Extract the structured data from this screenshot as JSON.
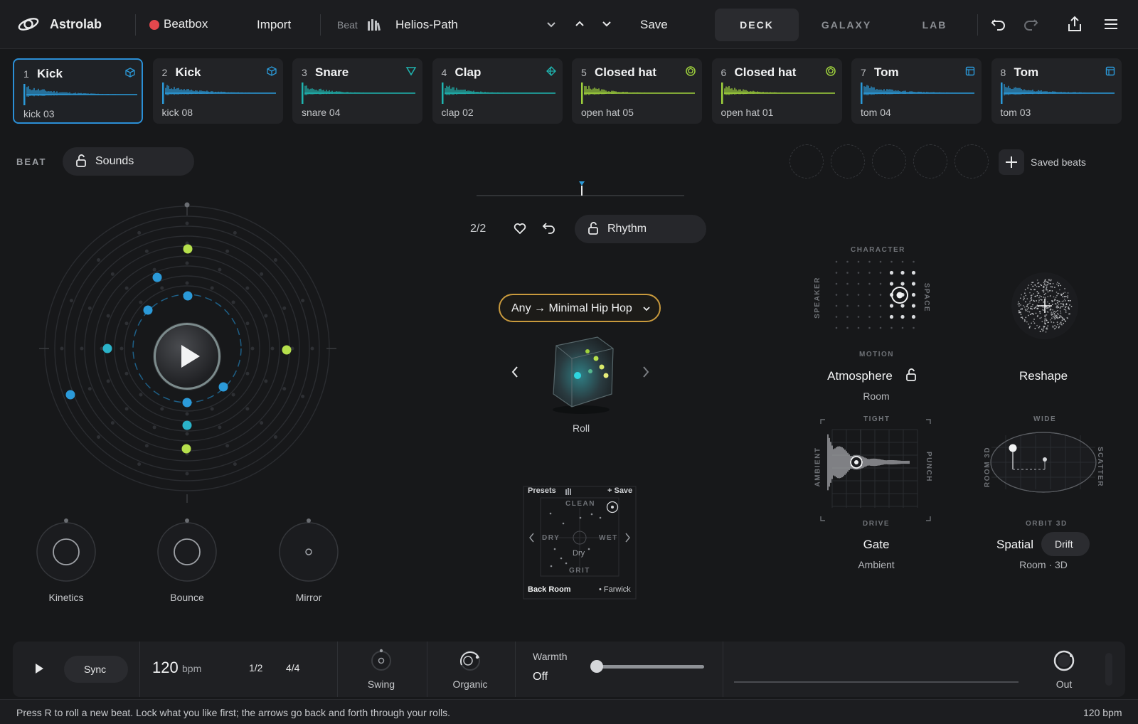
{
  "app": {
    "name": "Astrolab"
  },
  "topbar": {
    "mode_label": "Beatbox",
    "import_label": "Import",
    "beat_prefix": "Beat",
    "beat_name": "Helios-Path",
    "save_label": "Save",
    "tabs": [
      {
        "label": "DECK",
        "active": true
      },
      {
        "label": "GALAXY",
        "active": false
      },
      {
        "label": "LAB",
        "active": false
      }
    ]
  },
  "tracks": [
    {
      "num": "1",
      "name": "Kick",
      "sample": "kick 03",
      "icon": "cube-icon",
      "color": "#2b9ad9",
      "selected": true
    },
    {
      "num": "2",
      "name": "Kick",
      "sample": "kick 08",
      "icon": "cube-icon",
      "color": "#2b9ad9",
      "selected": false
    },
    {
      "num": "3",
      "name": "Snare",
      "sample": "snare 04",
      "icon": "triangle-icon",
      "color": "#1fb5b0",
      "selected": false
    },
    {
      "num": "4",
      "name": "Clap",
      "sample": "clap 02",
      "icon": "diamond-icon",
      "color": "#1fb5b0",
      "selected": false
    },
    {
      "num": "5",
      "name": "Closed hat",
      "sample": "open hat 05",
      "icon": "dodecahedron-icon",
      "color": "#9fd23d",
      "selected": false
    },
    {
      "num": "6",
      "name": "Closed hat",
      "sample": "open hat 01",
      "icon": "dodecahedron-icon",
      "color": "#9fd23d",
      "selected": false
    },
    {
      "num": "7",
      "name": "Tom",
      "sample": "tom 04",
      "icon": "box-icon",
      "color": "#2b9ad9",
      "selected": false
    },
    {
      "num": "8",
      "name": "Tom",
      "sample": "tom 03",
      "icon": "box-icon",
      "color": "#2b9ad9",
      "selected": false
    }
  ],
  "beat_section": {
    "label": "BEAT",
    "sounds_label": "Sounds",
    "saved_beats_label": "Saved beats",
    "saved_slots": 5
  },
  "roll": {
    "counter": "2/2",
    "rhythm_label": "Rhythm",
    "genre_label": "Any → Minimal Hip Hop",
    "roll_label": "Roll"
  },
  "knobs": [
    {
      "label": "Kinetics"
    },
    {
      "label": "Bounce"
    },
    {
      "label": "Mirror"
    }
  ],
  "presets": {
    "title": "Presets",
    "save": "+ Save",
    "top": "CLEAN",
    "left": "DRY",
    "right": "WET",
    "bottom": "GRIT",
    "center": "Dry",
    "preset_a": "Back Room",
    "preset_b": "• Farwick"
  },
  "atmosphere": {
    "title": "Atmosphere",
    "sub": "Room",
    "axis_top": "CHARACTER",
    "axis_bottom": "MOTION",
    "axis_left": "SPEAKER",
    "axis_right": "SPACE"
  },
  "reshape": {
    "title": "Reshape"
  },
  "gate": {
    "title": "Gate",
    "sub": "Ambient",
    "axis_top": "TIGHT",
    "axis_bottom": "DRIVE",
    "axis_left": "AMBIENT",
    "axis_right": "PUNCH"
  },
  "spatial": {
    "title": "Spatial",
    "drift_label": "Drift",
    "sub": "Room · 3D",
    "axis_top": "WIDE",
    "axis_bottom": "ORBIT 3D",
    "axis_left": "ROOM 3D",
    "axis_right": "SCATTER"
  },
  "transport": {
    "sync_label": "Sync",
    "tempo": "120",
    "tempo_unit": "bpm",
    "division": "1/2",
    "meter": "4/4",
    "swing_label": "Swing",
    "organic_label": "Organic",
    "warmth_label": "Warmth",
    "warmth_value": "Off",
    "out_label": "Out"
  },
  "status": {
    "hint": "Press R to roll a new beat. Lock what you like first; the arrows go back and forth through your rolls.",
    "bpm": "120 bpm"
  },
  "colors": {
    "accent_blue": "#2b9ad9",
    "teal": "#1fb5b0",
    "lime": "#9fd23d",
    "record": "#e5484d",
    "gold": "#c99a3d"
  }
}
